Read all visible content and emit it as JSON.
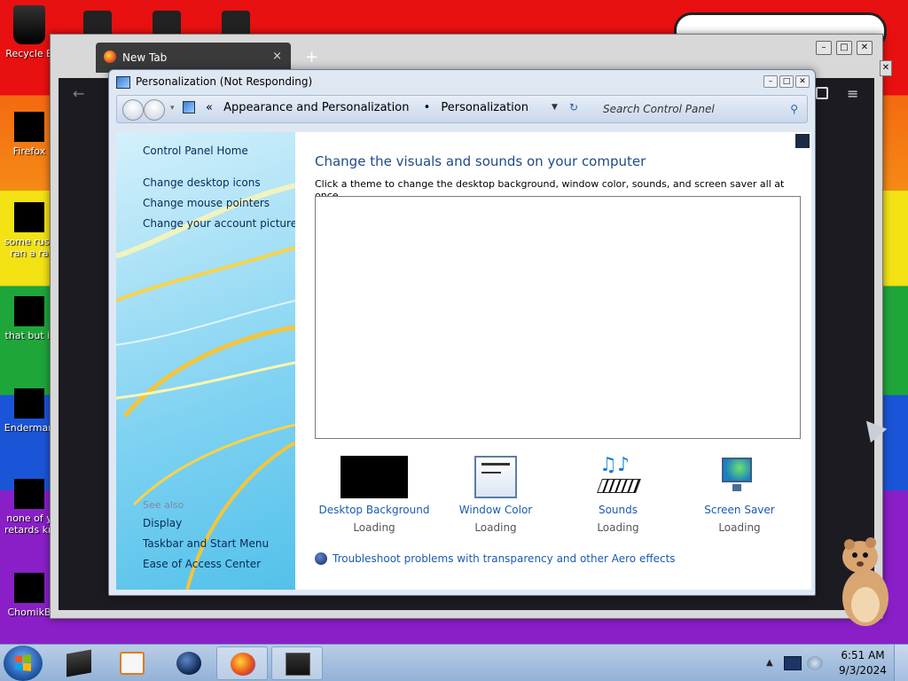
{
  "desktop": {
    "icons": [
      {
        "label": "Recycle B",
        "icon": "recycle-bin-icon"
      },
      {
        "label": "Firefox",
        "icon": "firefox-icon"
      },
      {
        "label": "some russ\nran a ra",
        "icon": "file-icon"
      },
      {
        "label": "that but it",
        "icon": "file-icon"
      },
      {
        "label": "Enderman",
        "icon": "file-icon"
      },
      {
        "label": "none of y\nretards kn",
        "icon": "file-icon"
      },
      {
        "label": "ChomikB",
        "icon": "hamster-icon"
      }
    ]
  },
  "browser": {
    "tab_title": "New Tab",
    "tab_close": "×",
    "new_tab": "+"
  },
  "window": {
    "title": "Personalization (Not Responding)",
    "breadcrumb": {
      "arrow": "«",
      "items": [
        "Appearance and Personalization",
        "Personalization"
      ],
      "separator": "•"
    },
    "search_placeholder": "Search Control Panel",
    "left_pane": {
      "home": "Control Panel Home",
      "links": [
        "Change desktop icons",
        "Change mouse pointers",
        "Change your account picture"
      ],
      "see_also_heading": "See also",
      "see_also": [
        "Display",
        "Taskbar and Start Menu",
        "Ease of Access Center"
      ]
    },
    "main": {
      "heading": "Change the visuals and sounds on your computer",
      "subtitle": "Click a theme to change the desktop background, window color, sounds, and screen saver all at once.",
      "options": [
        {
          "name": "Desktop Background",
          "status": "Loading",
          "icon": "desktop-background-icon"
        },
        {
          "name": "Window Color",
          "status": "Loading",
          "icon": "window-color-icon"
        },
        {
          "name": "Sounds",
          "status": "Loading",
          "icon": "sounds-icon"
        },
        {
          "name": "Screen Saver",
          "status": "Loading",
          "icon": "screen-saver-icon"
        }
      ],
      "troubleshoot": "Troubleshoot problems with transparency and other Aero effects"
    }
  },
  "taskbar": {
    "time": "6:51 AM",
    "date": "9/3/2024"
  }
}
